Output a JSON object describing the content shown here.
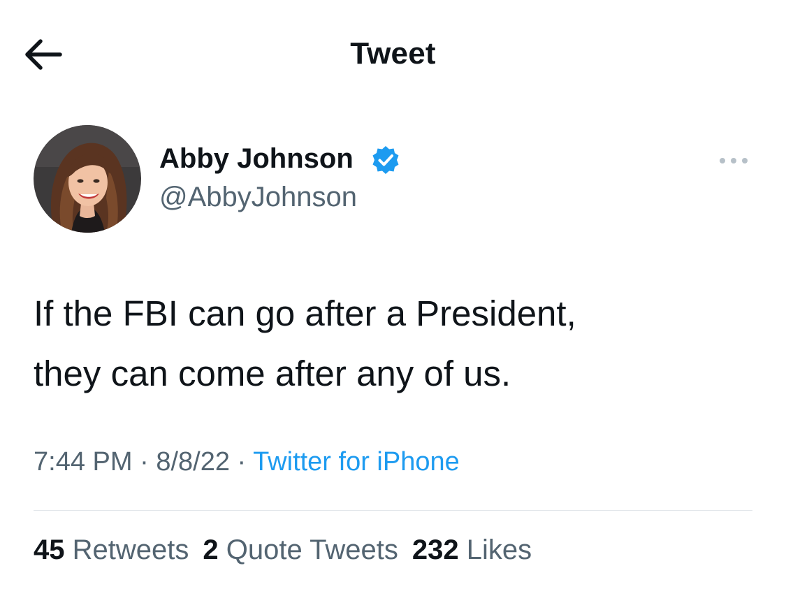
{
  "header": {
    "title": "Tweet",
    "back_icon": "arrow-left-icon"
  },
  "tweet": {
    "author": {
      "name": "Abby Johnson",
      "handle": "@AbbyJohnson",
      "verified": true
    },
    "text_lines": [
      "If the FBI can go after a President,",
      "they can come after any of us."
    ],
    "meta": {
      "time": "7:44 PM",
      "sep1": " · ",
      "date": "8/8/22",
      "sep2": " · ",
      "source": "Twitter for iPhone"
    },
    "stats": {
      "retweets": {
        "count": "45",
        "label": "Retweets"
      },
      "quote_tweets": {
        "count": "2",
        "label": "Quote Tweets"
      },
      "likes": {
        "count": "232",
        "label": "Likes"
      }
    }
  },
  "colors": {
    "text": "#0f1419",
    "secondary": "#536471",
    "accent": "#1d9bf0",
    "divider": "#e1e6ea"
  }
}
